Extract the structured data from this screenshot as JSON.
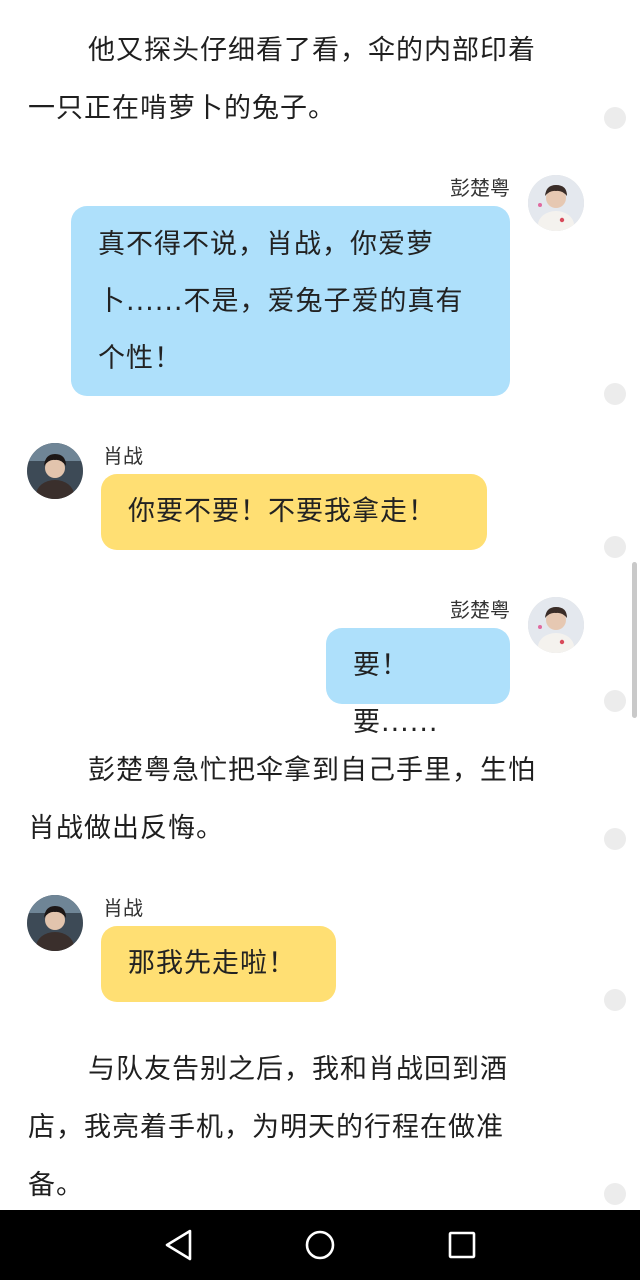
{
  "narration": [
    {
      "line1": "他又探头仔细看了看，伞的内部印着",
      "line2": "一只正在啃萝卜的兔子。"
    },
    {
      "line1": "彭楚粤急忙把伞拿到自己手里，生怕",
      "line2": "肖战做出反悔。"
    },
    {
      "line1": "与队友告别之后，我和肖战回到酒",
      "line2": "店，我亮着手机，为明天的行程在做准",
      "line3": "备。"
    }
  ],
  "messages": [
    {
      "sender": "彭楚粤",
      "lines": [
        "真不得不说，肖战，你爱萝",
        "卜......不是，爱兔子爱的真有",
        "个性！"
      ]
    },
    {
      "sender": "肖战",
      "text": "你要不要！不要我拿走！"
    },
    {
      "sender": "彭楚粤",
      "text": "要！要......"
    },
    {
      "sender": "肖战",
      "text": "那我先走啦！"
    }
  ],
  "icons": {
    "avatar_right": "avatar-icon",
    "avatar_left": "avatar-icon",
    "back": "back-triangle-icon",
    "home": "home-circle-icon",
    "recents": "recents-square-icon"
  },
  "colors": {
    "bubble_right": "#aee0fb",
    "bubble_left": "#ffdf73",
    "nav_bar": "#000000"
  }
}
